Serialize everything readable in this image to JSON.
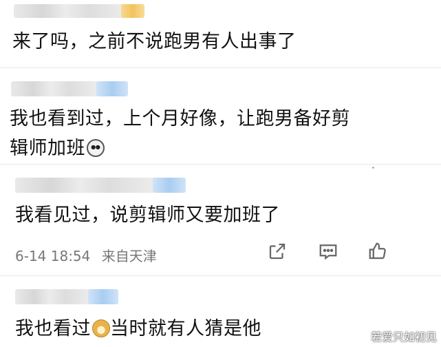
{
  "comments": [
    {
      "text": "来了吗，之前不说跑男有人出事了"
    },
    {
      "line1": "我也看到过，上个月好像，让跑男备好剪",
      "line2": "辑师加班",
      "emoji": "panda-emoji"
    },
    {
      "text": "我看见过，说剪辑师又要加班了",
      "date": "6-14 18:54",
      "location": "来自天津"
    },
    {
      "text_before": "我也看过",
      "text_after": "当时就有人猜是他",
      "emoji": "doge-emoji"
    }
  ],
  "actions": [
    {
      "name": "share-icon"
    },
    {
      "name": "comment-icon"
    },
    {
      "name": "like-icon"
    }
  ],
  "watermark": "若爱只如初见"
}
